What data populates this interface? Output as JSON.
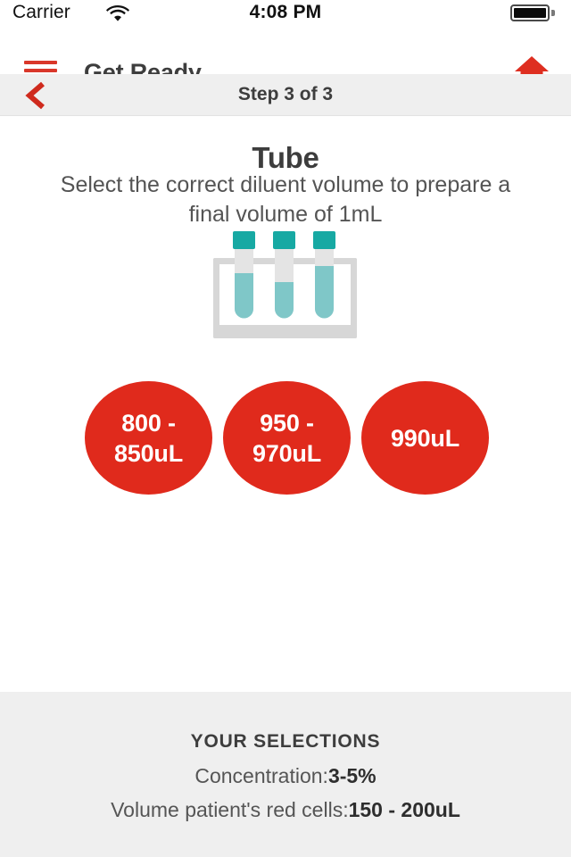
{
  "status_bar": {
    "carrier": "Carrier",
    "wifi_icon": "wifi-icon",
    "time": "4:08 PM",
    "battery_icon": "battery-full-icon"
  },
  "nav_bar": {
    "menu_icon": "hamburger-menu-icon",
    "title": "Get Ready",
    "home_icon": "home-icon"
  },
  "step_bar": {
    "back_icon": "chevron-left-icon",
    "label": "Step 3 of 3"
  },
  "content": {
    "title": "Tube",
    "description": "Select the correct diluent volume to prepare a final volume of 1mL",
    "illustration": "test-tube-rack-icon",
    "options": [
      {
        "line1": "800 -",
        "line2": "850uL",
        "value": "800 - 850uL"
      },
      {
        "line1": "950 -",
        "line2": "970uL",
        "value": "950 - 970uL"
      },
      {
        "line1": "990uL",
        "line2": "",
        "value": "990uL"
      }
    ]
  },
  "footer": {
    "title": "YOUR SELECTIONS",
    "rows": [
      {
        "label": "Concentration:",
        "value": "3-5%"
      },
      {
        "label": "Volume patient's red cells:",
        "value": "150 - 200uL"
      }
    ]
  },
  "colors": {
    "brand_red": "#e02a1c",
    "teal_cap": "#17a9a3",
    "teal_liquid": "#7fc7c8",
    "rack_gray": "#d6d6d6",
    "footer_gray": "#efefef",
    "text_dark": "#3d3d3d"
  }
}
